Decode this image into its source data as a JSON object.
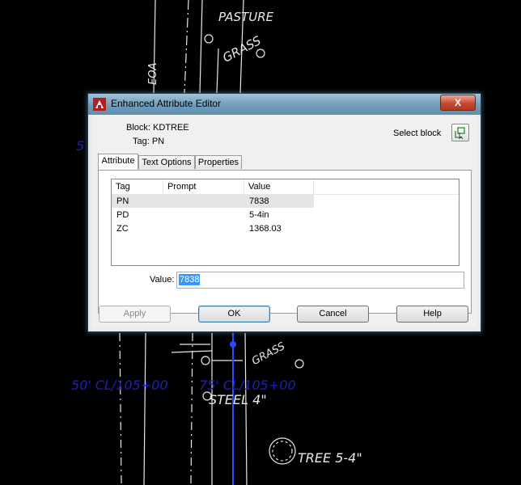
{
  "cad": {
    "labels": [
      "PASTURE",
      "GRASS",
      "EOA",
      "GRASS",
      "STEEL 4\"",
      "TREE 5-4\"",
      "50' CL/105+00",
      "75' CL/105+00",
      "5"
    ],
    "colors": {
      "white": "#e8e8e8",
      "blue": "#1f1fc0",
      "marker": "#2a4cff"
    }
  },
  "dialog": {
    "title": "Enhanced Attribute Editor",
    "close_label": "X",
    "block_label": "Block: KDTREE",
    "tag_label": "Tag: PN",
    "select_block_label": "Select block",
    "tabs": [
      "Attribute",
      "Text Options",
      "Properties"
    ],
    "columns": [
      "Tag",
      "Prompt",
      "Value"
    ],
    "rows": [
      {
        "tag": "PN",
        "prompt": "",
        "value": "7838"
      },
      {
        "tag": "PD",
        "prompt": "",
        "value": "5-4in"
      },
      {
        "tag": "ZC",
        "prompt": "",
        "value": "1368.03"
      }
    ],
    "value_label": "Value:",
    "value_text": "7838",
    "buttons": {
      "apply": "Apply",
      "ok": "OK",
      "cancel": "Cancel",
      "help": "Help"
    }
  }
}
